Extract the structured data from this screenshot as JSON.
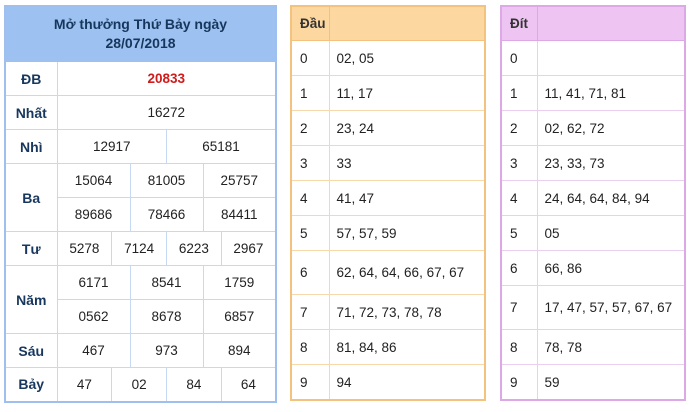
{
  "results": {
    "title_line1": "Mở thưởng Thứ Bảy ngày",
    "title_line2": "28/07/2018",
    "prizes": {
      "db": {
        "label": "ĐB",
        "numbers": [
          "20833"
        ]
      },
      "nhat": {
        "label": "Nhất",
        "numbers": [
          "16272"
        ]
      },
      "nhi": {
        "label": "Nhì",
        "numbers": [
          "12917",
          "65181"
        ]
      },
      "ba": {
        "label": "Ba",
        "numbers": [
          "15064",
          "81005",
          "25757",
          "89686",
          "78466",
          "84411"
        ]
      },
      "tu": {
        "label": "Tư",
        "numbers": [
          "5278",
          "7124",
          "6223",
          "2967"
        ]
      },
      "nam": {
        "label": "Năm",
        "numbers": [
          "6171",
          "8541",
          "1759",
          "0562",
          "8678",
          "6857"
        ]
      },
      "sau": {
        "label": "Sáu",
        "numbers": [
          "467",
          "973",
          "894"
        ]
      },
      "bay": {
        "label": "Bảy",
        "numbers": [
          "47",
          "02",
          "84",
          "64"
        ]
      }
    }
  },
  "dau": {
    "header": "Đầu",
    "rows": [
      {
        "key": "0",
        "values": "02, 05"
      },
      {
        "key": "1",
        "values": "11, 17"
      },
      {
        "key": "2",
        "values": "23, 24"
      },
      {
        "key": "3",
        "values": "33"
      },
      {
        "key": "4",
        "values": "41, 47"
      },
      {
        "key": "5",
        "values": "57, 57, 59"
      },
      {
        "key": "6",
        "values": "62, 64, 64, 66, 67, 67"
      },
      {
        "key": "7",
        "values": "71, 72, 73, 78, 78"
      },
      {
        "key": "8",
        "values": "81, 84, 86"
      },
      {
        "key": "9",
        "values": "94"
      }
    ]
  },
  "dit": {
    "header": "Đít",
    "rows": [
      {
        "key": "0",
        "values": ""
      },
      {
        "key": "1",
        "values": "11, 41, 71, 81"
      },
      {
        "key": "2",
        "values": "02, 62, 72"
      },
      {
        "key": "3",
        "values": "23, 33, 73"
      },
      {
        "key": "4",
        "values": "24, 64, 64, 84, 94"
      },
      {
        "key": "5",
        "values": "05"
      },
      {
        "key": "6",
        "values": "66, 86"
      },
      {
        "key": "7",
        "values": "17, 47, 57, 57, 67, 67"
      },
      {
        "key": "8",
        "values": "78, 78"
      },
      {
        "key": "9",
        "values": "59"
      }
    ]
  },
  "colors": {
    "results_header": "#9dc2f1",
    "special_prize": "#d11a1a",
    "dau_header": "#fcd7a0",
    "dit_header": "#eec5f2"
  }
}
